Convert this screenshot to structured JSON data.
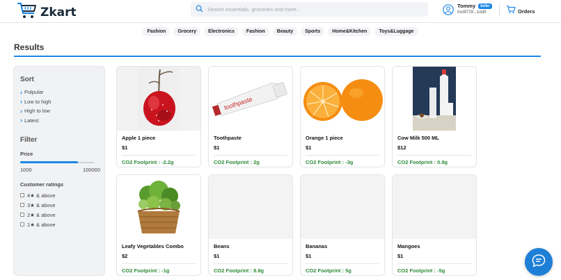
{
  "app": {
    "logo_text": "Zkart"
  },
  "search": {
    "placeholder": "Search essentials, groceries and more..."
  },
  "user": {
    "name": "Tommy",
    "badge": "Seller",
    "address": "0xd9729...1dd9"
  },
  "orders": {
    "label": "Orders"
  },
  "categories": [
    "Fashion",
    "Grocery",
    "Electronics",
    "Fashion",
    "Beauty",
    "Sports",
    "Home&Kitchen",
    "Toys&Luggage"
  ],
  "results": {
    "title": "Results"
  },
  "sidebar": {
    "sort_title": "Sort",
    "sort_options": [
      "Polpular",
      "Low to high",
      "High to low",
      "Latest"
    ],
    "filter_title": "Filter",
    "price_label": "Price",
    "price_min": "1000",
    "price_max": "100000",
    "price_fill_fraction": 0.78,
    "ratings_title": "Customer ratings",
    "ratings": [
      "4★ & above",
      "3★ & above",
      "2★ & above",
      "1★ & above"
    ]
  },
  "products": [
    {
      "name": "Apple 1 piece",
      "price": "$1",
      "co2": "CO2 Footprint : -2.2g",
      "image": "apple"
    },
    {
      "name": "Toothpaste",
      "price": "$1",
      "co2": "CO2 Footprint : 2g",
      "image": "toothpaste"
    },
    {
      "name": "Orange 1 piece",
      "price": "$1",
      "co2": "CO2 Footprint : -3g",
      "image": "orange"
    },
    {
      "name": "Cow Milk 500 ML",
      "price": "$12",
      "co2": "CO2 Footprint : 0.9g",
      "image": "milk"
    },
    {
      "name": "Leafy Vegetables Combo",
      "price": "$2",
      "co2": "CO2 Footprint : -1g",
      "image": "vegetables"
    },
    {
      "name": "Beans",
      "price": "$1",
      "co2": "CO2 Footprint : 8.8g",
      "image": ""
    },
    {
      "name": "Bananas",
      "price": "$1",
      "co2": "CO2 Footprint : 5g",
      "image": ""
    },
    {
      "name": "Mangoes",
      "price": "$1",
      "co2": "CO2 Footprint : -5g",
      "image": ""
    }
  ],
  "toothpaste_print": "toothpaste",
  "colors": {
    "accent": "#1e88e5",
    "co2_green": "#2e8b3a",
    "chat_button": "#1e7fd6"
  }
}
